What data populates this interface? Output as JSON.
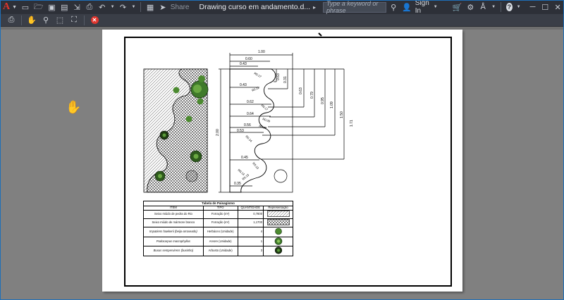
{
  "app": {
    "logo_letter": "A",
    "share_label": "Share",
    "document_title": "Drawing curso em andamento.d...",
    "search_placeholder": "Type a keyword or phrase",
    "sign_in_label": "Sign In",
    "help_label": "?",
    "accent_color": "#1e6fb8"
  },
  "drawing": {
    "dimensions": {
      "top_width": "1.00",
      "left_height": "2.00",
      "horizontal": [
        "0.60",
        "0.43",
        "0.43",
        "0.62",
        "0.64",
        "0.56",
        "0.53",
        "0.45",
        "0.35"
      ],
      "vertical": [
        "0.63",
        "0.31",
        "0.63",
        "0.79",
        "0.95",
        "1.09",
        "1.50",
        "1.71"
      ],
      "radii": [
        "R0.17",
        "R0.11",
        "R0.17",
        "R0.09",
        "R0.14",
        "R0.14",
        "R0.13",
        "R0.13",
        "R0.13"
      ]
    }
  },
  "table": {
    "caption": "Tabela de Paisagismo",
    "headers": [
      "ITEM",
      "TIPO",
      "QUANTIDADE",
      "Representação"
    ],
    "rows": [
      {
        "item": "Seixo miúdo de pedra do Rio",
        "tipo": "Forração (m²)",
        "qty": "0,7800",
        "rep": "hatch"
      },
      {
        "item": "Seixo miúdo de mármore branco",
        "tipo": "Forração (m²)",
        "qty": "1,1700",
        "rep": "pebble"
      },
      {
        "item": "Impatiens hawkerii (beijo-arroxeado)",
        "tipo": "Herbáceo (Unidade)",
        "qty": "4",
        "rep": "herb"
      },
      {
        "item": "Podocarpus macrophyllus",
        "tipo": "Arvore (Unidade)",
        "qty": "1",
        "rep": "tree"
      },
      {
        "item": "Buxus sempervirens (buxinho)",
        "tipo": "Arbusto (Unidade)",
        "qty": "3",
        "rep": "shrub"
      }
    ]
  }
}
